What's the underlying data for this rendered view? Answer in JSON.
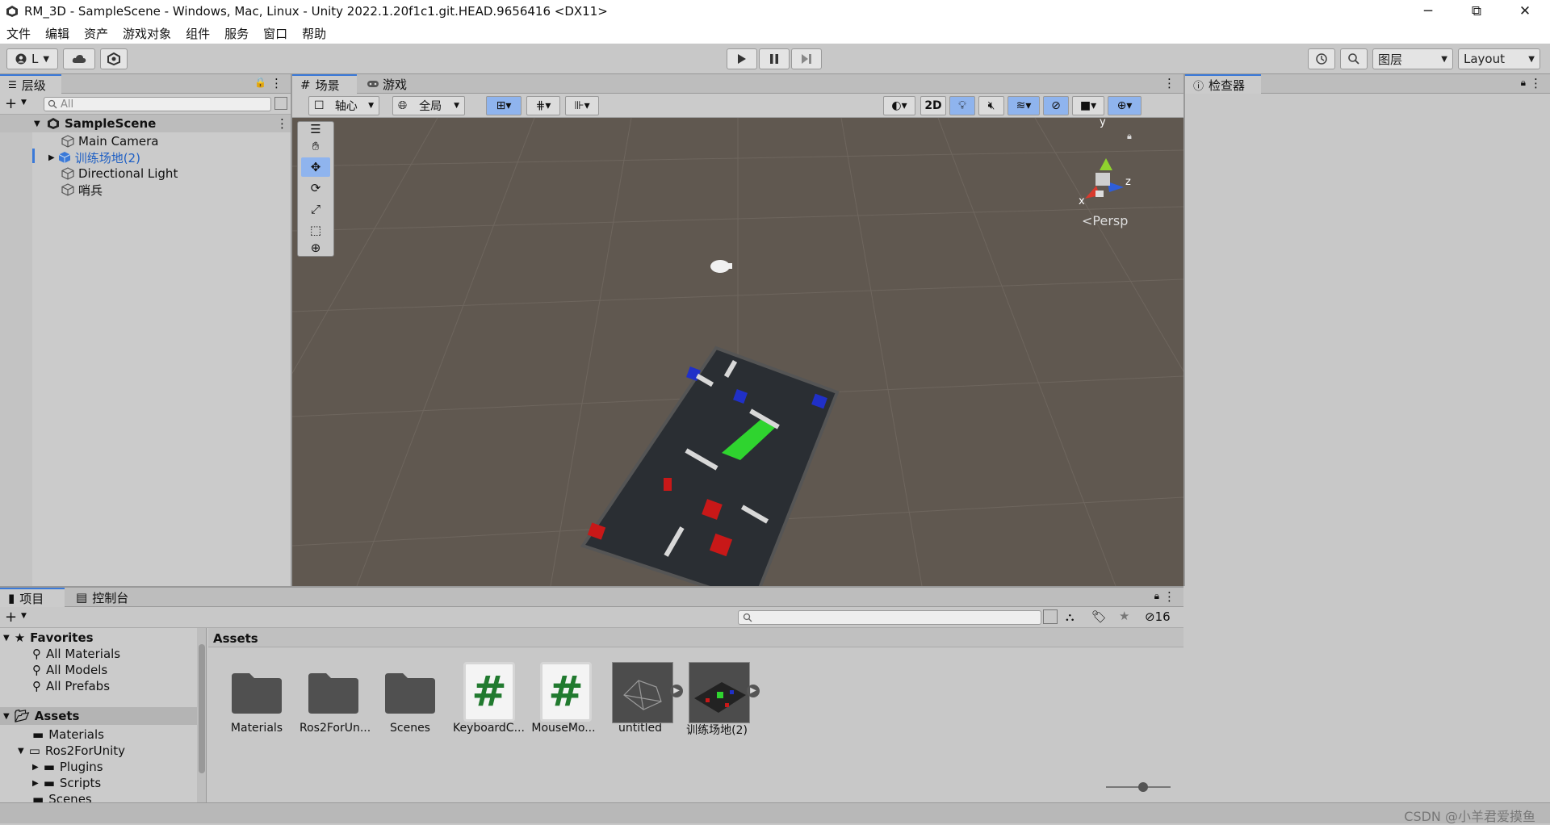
{
  "window": {
    "title": "RM_3D - SampleScene - Windows, Mac, Linux - Unity 2022.1.20f1c1.git.HEAD.9656416 <DX11>",
    "minimize": "─",
    "maximize": "⧉",
    "close": "✕"
  },
  "menu": [
    "文件",
    "编辑",
    "资产",
    "游戏对象",
    "组件",
    "服务",
    "窗口",
    "帮助"
  ],
  "toolbar": {
    "account": "L",
    "layers": "图层",
    "layout": "Layout"
  },
  "hierarchy": {
    "tab": "层级",
    "search_placeholder": "All",
    "scene": "SampleScene",
    "items": [
      "Main Camera",
      "训练场地(2)",
      "Directional Light",
      "哨兵"
    ]
  },
  "scene": {
    "tab_scene": "场景",
    "tab_game": "游戏",
    "pivot": "轴心",
    "global": "全局",
    "mode2d": "2D",
    "persp": "Persp",
    "axis_x": "x",
    "axis_y": "y",
    "axis_z": "z"
  },
  "inspector": {
    "tab": "检查器"
  },
  "project": {
    "tab_project": "项目",
    "tab_console": "控制台",
    "hidden_count": "16",
    "favorites_label": "Favorites",
    "favorites": [
      "All Materials",
      "All Models",
      "All Prefabs"
    ],
    "assets_label": "Assets",
    "tree": [
      "Materials",
      "Ros2ForUnity",
      "Plugins",
      "Scripts",
      "Scenes"
    ],
    "breadcrumb": "Assets",
    "assets": [
      {
        "name": "Materials",
        "type": "folder"
      },
      {
        "name": "Ros2ForUn...",
        "type": "folder"
      },
      {
        "name": "Scenes",
        "type": "folder"
      },
      {
        "name": "KeyboardC...",
        "type": "script"
      },
      {
        "name": "MouseMo...",
        "type": "script"
      },
      {
        "name": "untitled",
        "type": "model"
      },
      {
        "name": "训练场地(2)",
        "type": "prefab"
      }
    ]
  },
  "watermark": "CSDN @小羊君爱摸鱼",
  "colors": {
    "accent": "#3a79d8",
    "scene_bg": "#605850",
    "selected_text": "#1e5fc4"
  }
}
